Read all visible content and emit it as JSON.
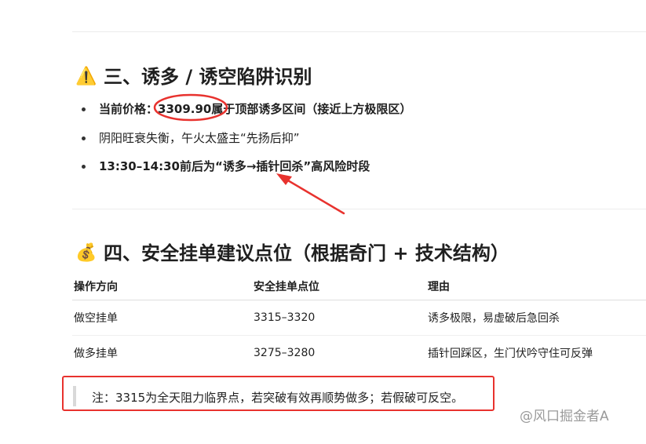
{
  "section3": {
    "icon": "warning-icon",
    "icon_glyph": "⚠️",
    "title": "三、诱多 / 诱空陷阱识别",
    "bullets": [
      {
        "bold": true,
        "prefix": "当前价格：",
        "price": "3309.90",
        "suffix": " 属于顶部诱多区间（接近上方极限区）"
      },
      {
        "bold": false,
        "text": "阴阳旺衰失衡，午火太盛主“先扬后抑”"
      },
      {
        "bold": true,
        "text": "13:30–14:30前后为“诱多→插针回杀”高风险时段"
      }
    ]
  },
  "section4": {
    "icon": "money-bag-icon",
    "icon_glyph": "💰",
    "title": "四、安全挂单建议点位（根据奇门 + 技术结构）",
    "table": {
      "headers": [
        "操作方向",
        "安全挂单点位",
        "理由"
      ],
      "rows": [
        [
          "做空挂单",
          "3315–3320",
          "诱多极限，易虚破后急回杀"
        ],
        [
          "做多挂单",
          "3275–3280",
          "插针回踩区，生门伏吟守住可反弹"
        ]
      ]
    }
  },
  "note": {
    "text": "注：3315为全天阻力临界点，若突破有效再顺势做多；若假破可反空。"
  },
  "watermark": "@风口掘金者A",
  "annotation_color": "#e8322e"
}
